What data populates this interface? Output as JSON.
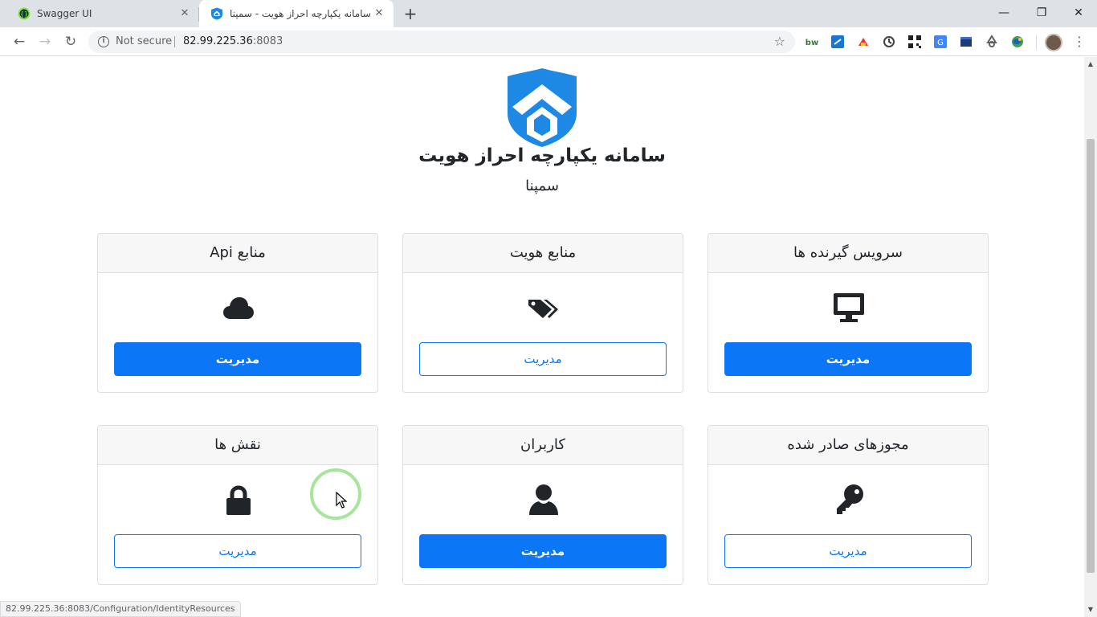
{
  "browser": {
    "tabs": [
      {
        "title": "Swagger UI",
        "active": false
      },
      {
        "title": "سامانه یکپارچه احراز هویت - سمپنا",
        "active": true
      }
    ],
    "new_tab": "+",
    "window_controls": {
      "minimize": "—",
      "maximize": "❐",
      "close": "✕"
    },
    "nav": {
      "back": "←",
      "forward": "→",
      "reload": "↻"
    },
    "address": {
      "security": "Not secure",
      "host": "82.99.225.36",
      "port": ":8083"
    },
    "menu": "⋮"
  },
  "page": {
    "title": "سامانه یکپارچه احراز هویت",
    "subtitle": "سمپنا",
    "cards": [
      {
        "header": "سرویس گیرنده ها",
        "icon": "desktop-icon",
        "button": "مدیریت",
        "style": "solid"
      },
      {
        "header": "منابع هویت",
        "icon": "tags-icon",
        "button": "مدیریت",
        "style": "outline"
      },
      {
        "header": "منابع Api",
        "icon": "cloud-icon",
        "button": "مدیریت",
        "style": "solid"
      },
      {
        "header": "مجوزهای صادر شده",
        "icon": "key-icon",
        "button": "مدیریت",
        "style": "outline"
      },
      {
        "header": "کاربران",
        "icon": "user-icon",
        "button": "مدیریت",
        "style": "solid"
      },
      {
        "header": "نقش ها",
        "icon": "lock-icon",
        "button": "مدیریت",
        "style": "outline"
      }
    ],
    "status_url": "82.99.225.36:8083/Configuration/IdentityResources"
  },
  "colors": {
    "primary": "#0b76f6",
    "logo": "#1e88e5",
    "text": "#212529",
    "card_header_bg": "#f7f7f7"
  }
}
